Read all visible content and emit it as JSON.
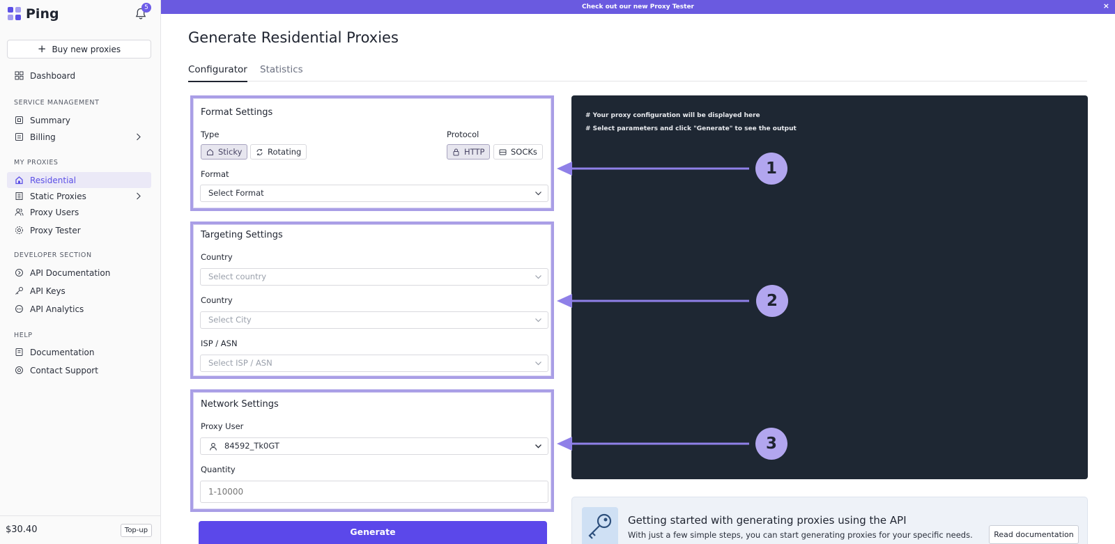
{
  "app": {
    "logo_text": "Ping",
    "notification_count": "5"
  },
  "banner": {
    "text": "Check out our new Proxy Tester",
    "close": "×"
  },
  "sidebar": {
    "buy_button": "Buy new proxies",
    "dashboard": "Dashboard",
    "sections": {
      "service_management": "SERVICE MANAGEMENT",
      "my_proxies": "MY PROXIES",
      "developer": "DEVELOPER SECTION",
      "help": "HELP"
    },
    "items": {
      "summary": "Summary",
      "billing": "Billing",
      "residential": "Residential",
      "static_proxies": "Static Proxies",
      "proxy_users": "Proxy Users",
      "proxy_tester": "Proxy Tester",
      "api_documentation": "API Documentation",
      "api_keys": "API Keys",
      "api_analytics": "API Analytics",
      "documentation": "Documentation",
      "contact_support": "Contact Support"
    },
    "balance": "$30.40",
    "topup": "Top-up"
  },
  "page": {
    "title": "Generate Residential Proxies",
    "tabs": {
      "configurator": "Configurator",
      "statistics": "Statistics"
    }
  },
  "format_settings": {
    "title": "Format Settings",
    "type_label": "Type",
    "type_options": {
      "sticky": "Sticky",
      "rotating": "Rotating"
    },
    "protocol_label": "Protocol",
    "protocol_options": {
      "http": "HTTP",
      "socks": "SOCKs"
    },
    "format_label": "Format",
    "format_value": "Select Format"
  },
  "targeting_settings": {
    "title": "Targeting Settings",
    "country_label": "Country",
    "country_placeholder": "Select country",
    "city_label": "Country",
    "city_placeholder": "Select City",
    "isp_label": "ISP / ASN",
    "isp_placeholder": "Select ISP / ASN"
  },
  "network_settings": {
    "title": "Network Settings",
    "proxy_user_label": "Proxy User",
    "proxy_user_value": "84592_Tk0GT",
    "quantity_label": "Quantity",
    "quantity_placeholder": "1-10000"
  },
  "generate_button": "Generate",
  "output": {
    "line1": "# Your proxy configuration will be displayed here",
    "line2": "# Select parameters and click \"Generate\" to see the output"
  },
  "callouts": {
    "one": "1",
    "two": "2",
    "three": "3"
  },
  "api_card": {
    "title": "Getting started with generating proxies using the API",
    "subtitle": "With just a few simple steps, you can start generating proxies for your specific needs.",
    "button": "Read documentation"
  },
  "colors": {
    "accent": "#5b48ea",
    "highlight": "#a99ee6",
    "output_bg": "#1e2733"
  }
}
